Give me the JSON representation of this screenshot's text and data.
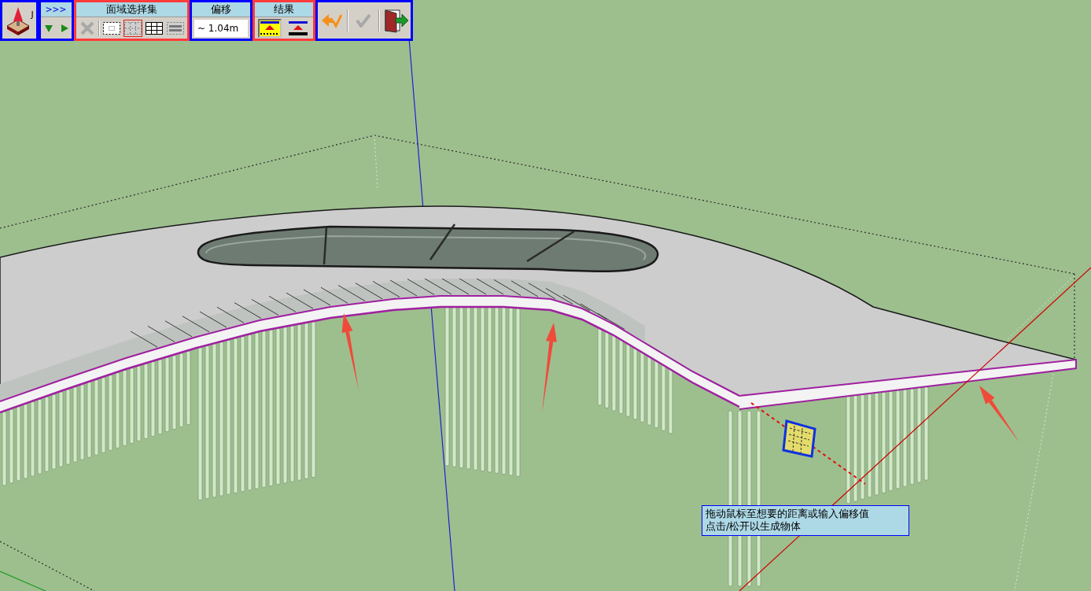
{
  "toolbar": {
    "logo": {
      "letter": "J"
    },
    "nav": {
      "expand_label": ">>>"
    },
    "sections": [
      {
        "kind": "selection",
        "title": "面域选择集",
        "highlighted": true,
        "tools": [
          {
            "kind": "delete",
            "disabled": true,
            "selected": false
          },
          {
            "kind": "window",
            "disabled": false,
            "selected": false
          },
          {
            "kind": "crossing",
            "disabled": false,
            "selected": true
          },
          {
            "kind": "grid",
            "disabled": false,
            "selected": false
          },
          {
            "kind": "strip",
            "disabled": false,
            "selected": false
          }
        ]
      },
      {
        "kind": "offset",
        "title": "偏移",
        "highlighted": false,
        "value": "~ 1.04m"
      },
      {
        "kind": "result",
        "title": "结果",
        "highlighted": true,
        "options": [
          {
            "kind": "above",
            "selected": true
          },
          {
            "kind": "below",
            "selected": false
          }
        ]
      }
    ],
    "actions": [
      {
        "kind": "undo",
        "disabled": false
      },
      {
        "kind": "confirm",
        "disabled": true
      },
      {
        "kind": "exit",
        "disabled": false
      }
    ]
  },
  "tooltip": {
    "lines": [
      "拖动鼠标至想要的距离或输入偏移值",
      "点击/松开以生成物体"
    ]
  }
}
